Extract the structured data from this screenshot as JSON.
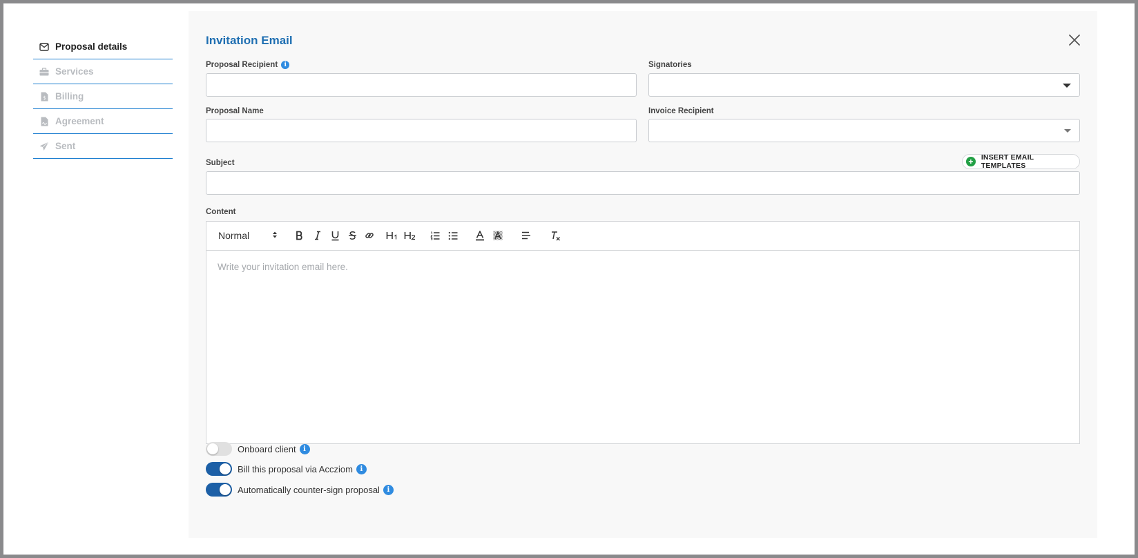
{
  "sidebar": {
    "items": [
      {
        "label": "Proposal details",
        "icon": "envelope-icon",
        "active": true
      },
      {
        "label": "Services",
        "icon": "briefcase-icon",
        "active": false
      },
      {
        "label": "Billing",
        "icon": "invoice-icon",
        "active": false
      },
      {
        "label": "Agreement",
        "icon": "document-signature-icon",
        "active": false
      },
      {
        "label": "Sent",
        "icon": "paper-plane-icon",
        "active": false
      }
    ]
  },
  "panel": {
    "title": "Invitation Email",
    "fields": {
      "proposal_recipient": {
        "label": "Proposal Recipient",
        "value": ""
      },
      "signatories": {
        "label": "Signatories",
        "value": ""
      },
      "proposal_name": {
        "label": "Proposal Name",
        "value": ""
      },
      "invoice_recipient": {
        "label": "Invoice Recipient",
        "value": ""
      },
      "subject": {
        "label": "Subject",
        "value": ""
      },
      "content": {
        "label": "Content"
      }
    },
    "insert_templates_label": "INSERT EMAIL TEMPLATES",
    "editor": {
      "format_value": "Normal",
      "placeholder": "Write your invitation email here.",
      "tools": [
        "bold",
        "italic",
        "underline",
        "strikethrough",
        "link",
        "heading-1",
        "heading-2",
        "ordered-list",
        "bullet-list",
        "text-color",
        "background-color",
        "align",
        "clear-format"
      ]
    },
    "toggles": [
      {
        "label": "Onboard client",
        "on": false
      },
      {
        "label": "Bill this proposal via Accziom",
        "on": true
      },
      {
        "label": "Automatically counter-sign proposal",
        "on": true
      }
    ]
  },
  "colors": {
    "accent": "#1e7fd0",
    "title": "#1f6fb2",
    "toggle_on": "#1c5fa6",
    "add_green": "#22a045"
  }
}
